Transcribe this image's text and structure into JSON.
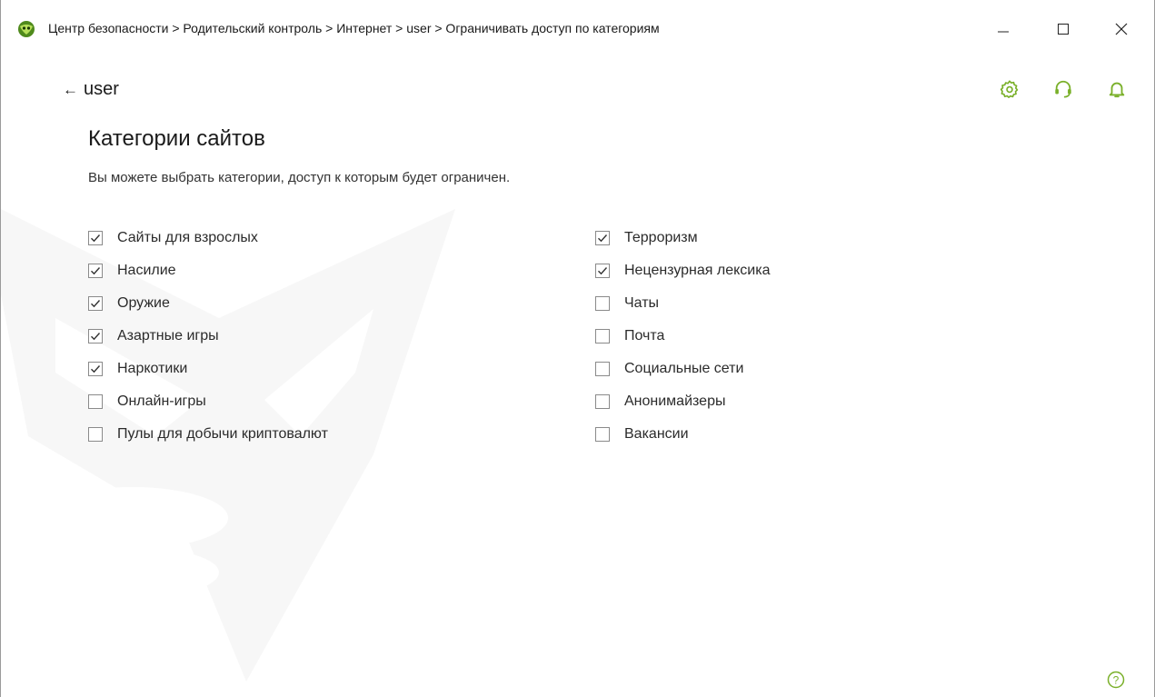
{
  "window": {
    "title": "Центр безопасности > Родительский контроль > Интернет > user > Ограничивать доступ по категориям",
    "minimize_icon": "minimize-icon",
    "maximize_icon": "maximize-icon",
    "close_icon": "close-icon"
  },
  "header": {
    "back_label": "user",
    "back_icon": "arrow-left-icon",
    "icons": [
      "gear-icon",
      "headset-icon",
      "bell-icon"
    ],
    "accent_color": "#7ab02a"
  },
  "page": {
    "title": "Категории сайтов",
    "description": "Вы можете выбрать категории, доступ к которым будет ограничен."
  },
  "categories": {
    "left": [
      {
        "label": "Сайты для взрослых",
        "checked": true
      },
      {
        "label": "Насилие",
        "checked": true
      },
      {
        "label": "Оружие",
        "checked": true
      },
      {
        "label": "Азартные игры",
        "checked": true
      },
      {
        "label": "Наркотики",
        "checked": true
      },
      {
        "label": "Онлайн-игры",
        "checked": false
      },
      {
        "label": "Пулы для добычи криптовалют",
        "checked": false
      }
    ],
    "right": [
      {
        "label": "Терроризм",
        "checked": true
      },
      {
        "label": "Нецензурная лексика",
        "checked": true
      },
      {
        "label": "Чаты",
        "checked": false
      },
      {
        "label": "Почта",
        "checked": false
      },
      {
        "label": "Социальные сети",
        "checked": false
      },
      {
        "label": "Анонимайзеры",
        "checked": false
      },
      {
        "label": "Вакансии",
        "checked": false
      }
    ]
  },
  "footer": {
    "help_icon": "help-icon"
  }
}
